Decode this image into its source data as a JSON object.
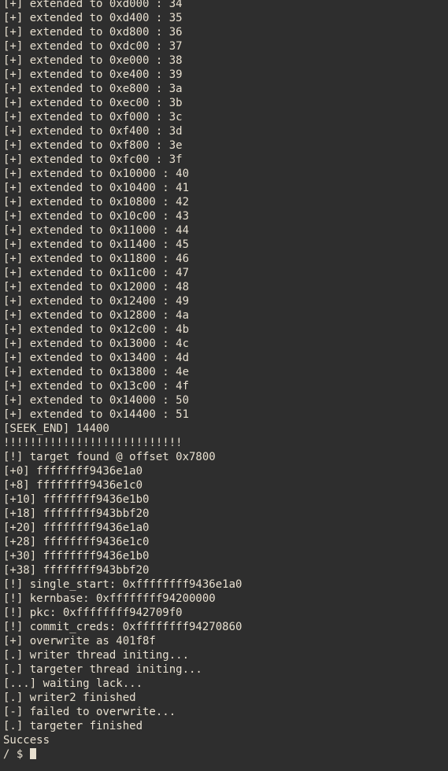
{
  "terminal": {
    "background_color": "#2e2e2e",
    "foreground_color": "#e8e0d0",
    "columns": 70,
    "rows": 54,
    "prompt": "/ $ ",
    "cursor": "block"
  },
  "log": {
    "extend_prefix": "[+] extended to ",
    "extend_separator": " : ",
    "extend_lines": [
      {
        "address": "0xd000",
        "index": "34"
      },
      {
        "address": "0xd400",
        "index": "35"
      },
      {
        "address": "0xd800",
        "index": "36"
      },
      {
        "address": "0xdc00",
        "index": "37"
      },
      {
        "address": "0xe000",
        "index": "38"
      },
      {
        "address": "0xe400",
        "index": "39"
      },
      {
        "address": "0xe800",
        "index": "3a"
      },
      {
        "address": "0xec00",
        "index": "3b"
      },
      {
        "address": "0xf000",
        "index": "3c"
      },
      {
        "address": "0xf400",
        "index": "3d"
      },
      {
        "address": "0xf800",
        "index": "3e"
      },
      {
        "address": "0xfc00",
        "index": "3f"
      },
      {
        "address": "0x10000",
        "index": "40"
      },
      {
        "address": "0x10400",
        "index": "41"
      },
      {
        "address": "0x10800",
        "index": "42"
      },
      {
        "address": "0x10c00",
        "index": "43"
      },
      {
        "address": "0x11000",
        "index": "44"
      },
      {
        "address": "0x11400",
        "index": "45"
      },
      {
        "address": "0x11800",
        "index": "46"
      },
      {
        "address": "0x11c00",
        "index": "47"
      },
      {
        "address": "0x12000",
        "index": "48"
      },
      {
        "address": "0x12400",
        "index": "49"
      },
      {
        "address": "0x12800",
        "index": "4a"
      },
      {
        "address": "0x12c00",
        "index": "4b"
      },
      {
        "address": "0x13000",
        "index": "4c"
      },
      {
        "address": "0x13400",
        "index": "4d"
      },
      {
        "address": "0x13800",
        "index": "4e"
      },
      {
        "address": "0x13c00",
        "index": "4f"
      },
      {
        "address": "0x14000",
        "index": "50"
      },
      {
        "address": "0x14400",
        "index": "51"
      }
    ],
    "seek_end_line": "[SEEK_END] 14400",
    "alert_bang_line": "!!!!!!!!!!!!!!!!!!!!!!!!!!!",
    "target_found_line": "[!] target found @ offset 0x7800",
    "dump_lines": [
      {
        "offset": "[+0]",
        "value": "ffffffff9436e1a0"
      },
      {
        "offset": "[+8]",
        "value": "ffffffff9436e1c0"
      },
      {
        "offset": "[+10]",
        "value": "ffffffff9436e1b0"
      },
      {
        "offset": "[+18]",
        "value": "ffffffff943bbf20"
      },
      {
        "offset": "[+20]",
        "value": "ffffffff9436e1a0"
      },
      {
        "offset": "[+28]",
        "value": "ffffffff9436e1c0"
      },
      {
        "offset": "[+30]",
        "value": "ffffffff9436e1b0"
      },
      {
        "offset": "[+38]",
        "value": "ffffffff943bbf20"
      }
    ],
    "symbol_lines": [
      "[!] single_start: 0xffffffff9436e1a0",
      "[!] kernbase: 0xffffffff94200000",
      "[!] pkc: 0xffffffff942709f0",
      "[!] commit_creds: 0xffffffff94270860"
    ],
    "status_lines": [
      "[+] overwrite as 401f8f",
      "[.] writer thread initing...",
      "[.] targeter thread initing...",
      "[...] waiting lack...",
      "[.] writer2 finished",
      "[-] failed to overwrite...",
      "[.] targeter finished",
      "Success"
    ]
  }
}
